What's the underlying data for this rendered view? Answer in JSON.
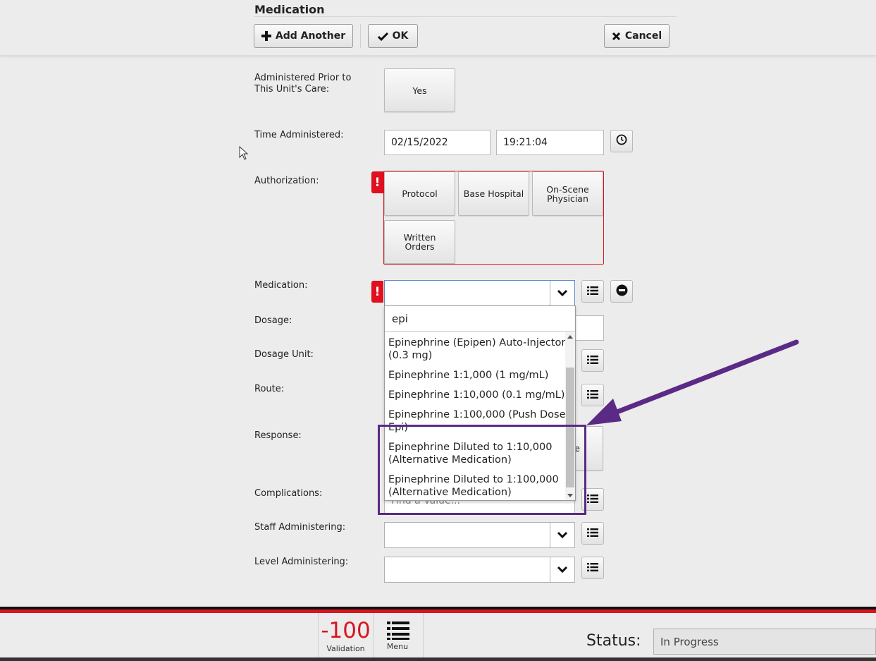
{
  "header": {
    "title": "Medication",
    "add_another_label": "Add Another",
    "ok_label": "OK",
    "cancel_label": "Cancel"
  },
  "form": {
    "administered_prior": {
      "label": "Administered Prior to This Unit's Care:",
      "button": "Yes"
    },
    "time_administered": {
      "label": "Time Administered:",
      "date": "02/15/2022",
      "time": "19:21:04"
    },
    "authorization": {
      "label": "Authorization:",
      "options": [
        "Protocol",
        "Base Hospital",
        "On-Scene Physician",
        "Written Orders"
      ]
    },
    "medication": {
      "label": "Medication:",
      "value": ""
    },
    "dosage": {
      "label": "Dosage:"
    },
    "dosage_unit": {
      "label": "Dosage Unit:"
    },
    "route": {
      "label": "Route:"
    },
    "response": {
      "label": "Response:",
      "partial_button": "e"
    },
    "complications": {
      "label": "Complications:",
      "placeholder": "Find a Value..."
    },
    "staff_administering": {
      "label": "Staff Administering:"
    },
    "level_administering": {
      "label": "Level Administering:"
    }
  },
  "dropdown": {
    "search_value": "epi",
    "items": [
      "Epinephrine (Epipen) Auto-Injector (0.3 mg)",
      "Epinephrine 1:1,000 (1 mg/mL)",
      "Epinephrine 1:10,000 (0.1 mg/mL)",
      "Epinephrine 1:100,000 (Push Dose Epi)",
      "Epinephrine Diluted to 1:10,000 (Alternative Medication)",
      "Epinephrine Diluted to 1:100,000 (Alternative Medication)"
    ]
  },
  "footer": {
    "validation_score": "-100",
    "validation_label": "Validation",
    "menu_label": "Menu",
    "status_label": "Status:",
    "status_value": "In Progress"
  },
  "colors": {
    "error_red": "#e0101e",
    "footer_red": "#d8161e",
    "annotation_purple": "#5b2a86",
    "score_red": "#d8161e"
  },
  "icons": [
    "plus-icon",
    "check-icon",
    "x-icon",
    "clock-icon",
    "chevron-down-icon",
    "list-icon",
    "minus-circle-icon",
    "exclamation-icon",
    "hamburger-icon",
    "cursor-icon"
  ]
}
